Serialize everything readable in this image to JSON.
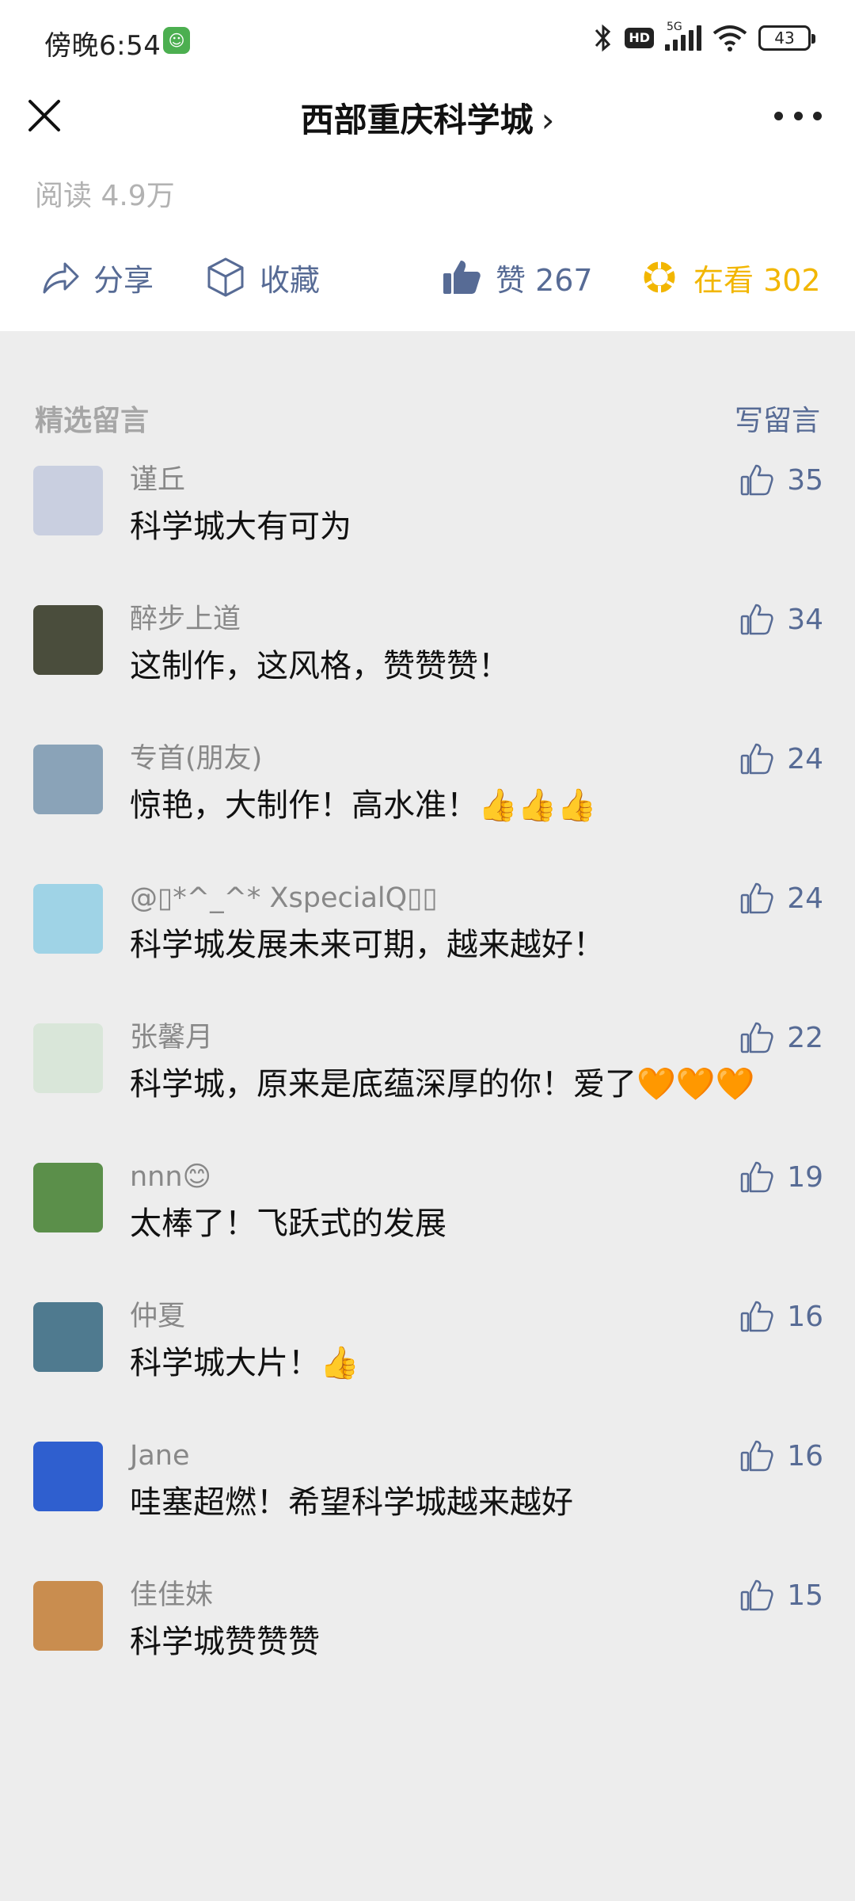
{
  "status_bar": {
    "time": "傍晚6:54",
    "network": "5G",
    "hd": "HD",
    "battery": "43"
  },
  "nav": {
    "title": "西部重庆科学城",
    "chevron": "›"
  },
  "article": {
    "reads": "阅读 4.9万"
  },
  "actions": {
    "share_label": "分享",
    "favorite_label": "收藏",
    "like_label": "赞 267",
    "wow_label": "在看 302"
  },
  "comments_section": {
    "title": "精选留言",
    "write_label": "写留言"
  },
  "comments": [
    {
      "name": "谨丘",
      "text": "科学城大有可为",
      "likes": "35",
      "avatar_color": "#c9cfe0"
    },
    {
      "name": "醉步上道",
      "text": "这制作，这风格，赞赞赞！",
      "likes": "34",
      "avatar_color": "#4a4d3c"
    },
    {
      "name": "专首(朋友)",
      "text": "惊艳，大制作！高水准！👍👍👍",
      "likes": "24",
      "avatar_color": "#8aa3b8"
    },
    {
      "name": "@▯*^_^* XspecialQ▯▯",
      "text": "科学城发展未来可期，越来越好！",
      "likes": "24",
      "avatar_color": "#9fd3e6"
    },
    {
      "name": "张馨月",
      "text": "科学城，原来是底蕴深厚的你！爱了🧡🧡🧡",
      "likes": "22",
      "avatar_color": "#d9e6d9"
    },
    {
      "name": "nnn😊",
      "text": "太棒了！飞跃式的发展",
      "likes": "19",
      "avatar_color": "#5b8f4a"
    },
    {
      "name": "仲夏",
      "text": "科学城大片！👍",
      "likes": "16",
      "avatar_color": "#4f7a8f"
    },
    {
      "name": "Jane",
      "text": "哇塞超燃！希望科学城越来越好",
      "likes": "16",
      "avatar_color": "#2f5fcf"
    },
    {
      "name": "佳佳妹",
      "text": "科学城赞赞赞",
      "likes": "15",
      "avatar_color": "#c98d4f"
    }
  ],
  "colors": {
    "link_blue": "#576b95",
    "wow_yellow": "#f2b600",
    "page_gray": "#ededed"
  }
}
